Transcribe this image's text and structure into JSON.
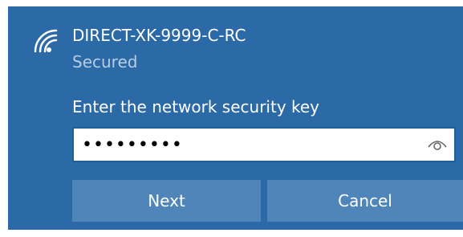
{
  "network": {
    "ssid": "DIRECT-XK-9999-C-RC",
    "status": "Secured",
    "icon": "wifi-secured-icon"
  },
  "security_key": {
    "prompt": "Enter the network security key",
    "masked_value": "•••••••••",
    "reveal_icon": "eye-icon"
  },
  "buttons": {
    "next_label": "Next",
    "cancel_label": "Cancel"
  },
  "colors": {
    "panel_background": "#2b6aa6",
    "button_background": "#4f85b8",
    "secondary_text": "#b7cde3"
  }
}
